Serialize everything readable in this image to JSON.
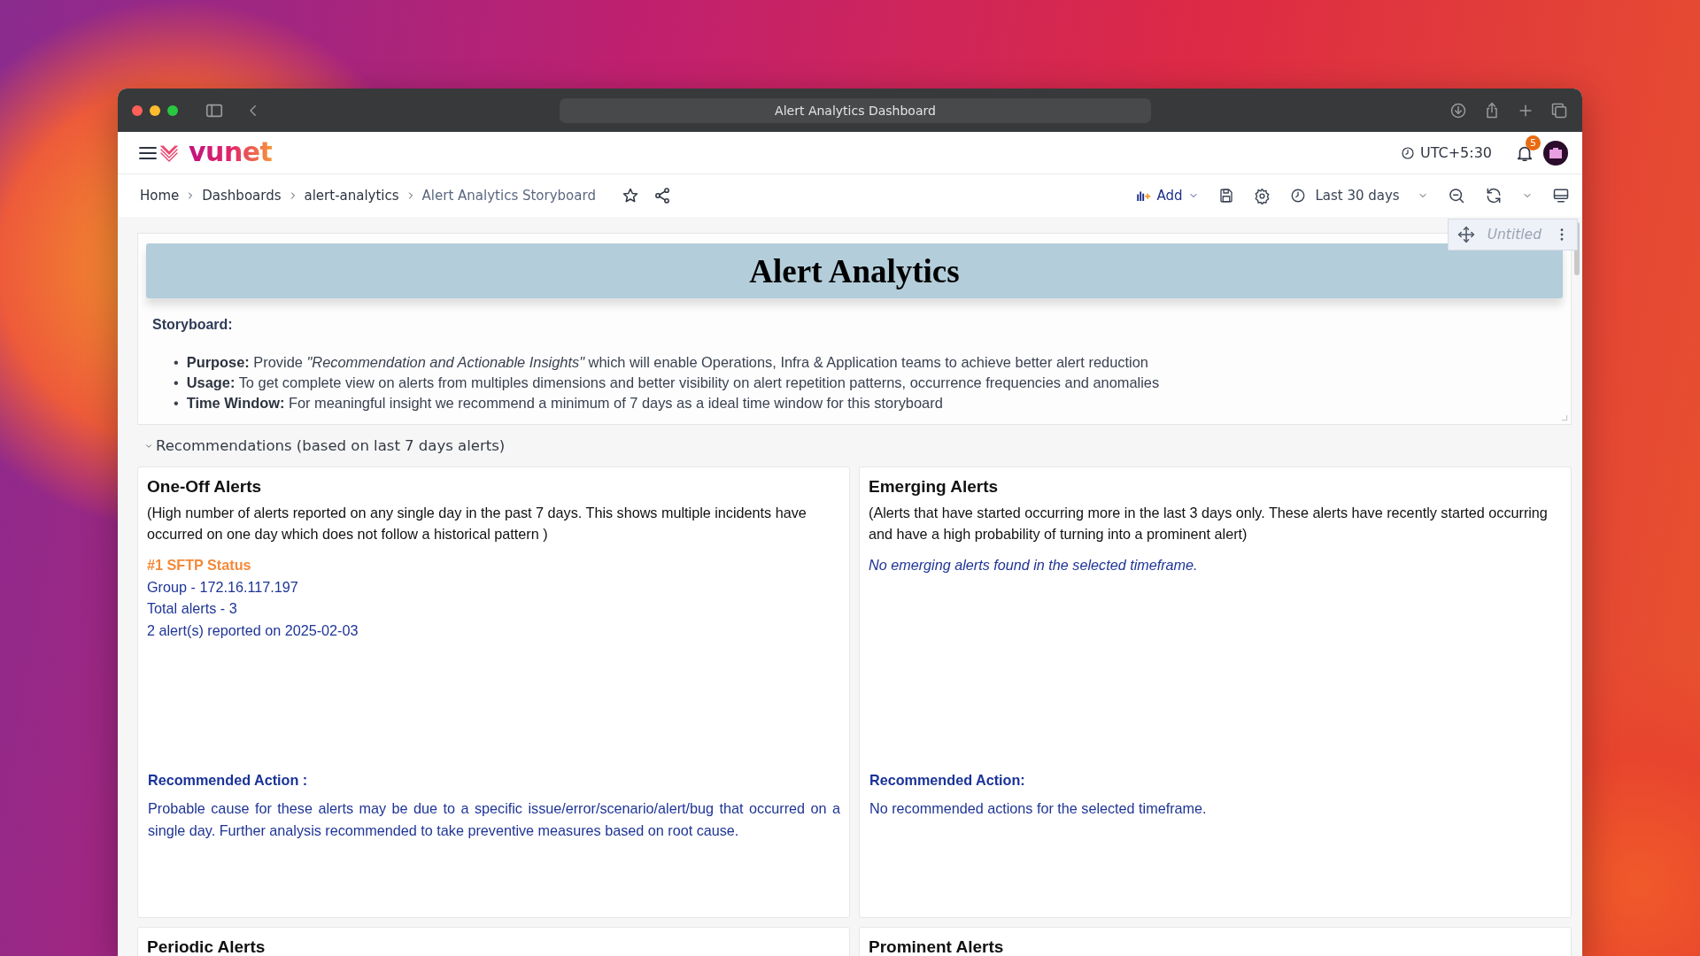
{
  "browser": {
    "title": "Alert Analytics Dashboard"
  },
  "header": {
    "logo_text": "vunet",
    "timezone": "UTC+5:30",
    "notification_count": "5"
  },
  "breadcrumbs": [
    {
      "label": "Home",
      "current": false
    },
    {
      "label": "Dashboards",
      "current": false
    },
    {
      "label": "alert-analytics",
      "current": false
    },
    {
      "label": "Alert Analytics Storyboard",
      "current": true
    }
  ],
  "toolbar": {
    "add_label": "Add",
    "time_range": "Last 30 days"
  },
  "panel_menu": {
    "title": "Untitled"
  },
  "storyboard": {
    "banner_title": "Alert Analytics",
    "label": "Storyboard:",
    "items": [
      {
        "marker": "•",
        "text": "**Purpose:** Provide *\"Recommendation and Actionable Insights\"* which will enable Operations, Infra & Application teams to achieve better alert reduction"
      },
      {
        "marker": "•",
        "text": "**Usage:** To get complete view on alerts from multiples dimensions and better visibility on alert repetition patterns, occurrence frequencies and anomalies"
      },
      {
        "marker": "•",
        "text": "**Time Window:** For meaningful insight we recommend a minimum of 7 days as a ideal time window for this storyboard"
      }
    ]
  },
  "section": {
    "title": "Recommendations (based on last 7 days alerts)",
    "expanded": true
  },
  "cards": [
    {
      "title": "One-Off Alerts",
      "description": "(High number of alerts reported on any single day in the past 7 days. This shows multiple incidents have occurred on one day which does not follow a historical pattern )",
      "findings": [
        {
          "kind": "heading",
          "text": "#1 SFTP Status"
        },
        {
          "kind": "line",
          "text": "Group - 172.16.117.197"
        },
        {
          "kind": "line",
          "text": "Total alerts - 3"
        },
        {
          "kind": "line",
          "text": "2 alert(s) reported on 2025-02-03"
        }
      ],
      "action_label": "Recommended Action :",
      "action_text": "Probable cause for these alerts may be due to a specific issue/error/scenario/alert/bug that occurred on a single day. Further analysis recommended to take preventive measures based on root cause."
    },
    {
      "title": "Emerging Alerts",
      "description": "(Alerts that have started occurring more in the last 3 days only. These alerts have recently started occurring and have a high probability of turning into a prominent alert)",
      "findings": [
        {
          "kind": "empty",
          "text": "No emerging alerts found in the selected timeframe."
        }
      ],
      "action_label": "Recommended Action:",
      "action_text": "No recommended actions for the selected timeframe."
    },
    {
      "title": "Periodic Alerts"
    },
    {
      "title": "Prominent Alerts"
    }
  ]
}
